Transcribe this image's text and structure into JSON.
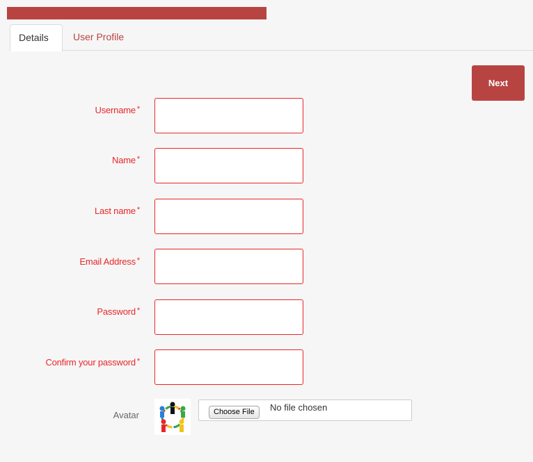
{
  "tabs": [
    {
      "label": "Details",
      "active": true
    },
    {
      "label": "User Profile",
      "active": false
    }
  ],
  "toolbar": {
    "next_label": "Next"
  },
  "form": {
    "required_marker": "*",
    "fields": [
      {
        "label": "Username",
        "value": ""
      },
      {
        "label": "Name",
        "value": ""
      },
      {
        "label": "Last name",
        "value": ""
      },
      {
        "label": "Email Address",
        "value": ""
      },
      {
        "label": "Password",
        "value": ""
      },
      {
        "label": "Confirm your password",
        "value": ""
      }
    ],
    "avatar": {
      "label": "Avatar",
      "choose_file_label": "Choose File",
      "file_status": "No file chosen"
    }
  },
  "colors": {
    "brand": "#b84442",
    "required": "#e8262a",
    "background": "#f6f6f6"
  }
}
